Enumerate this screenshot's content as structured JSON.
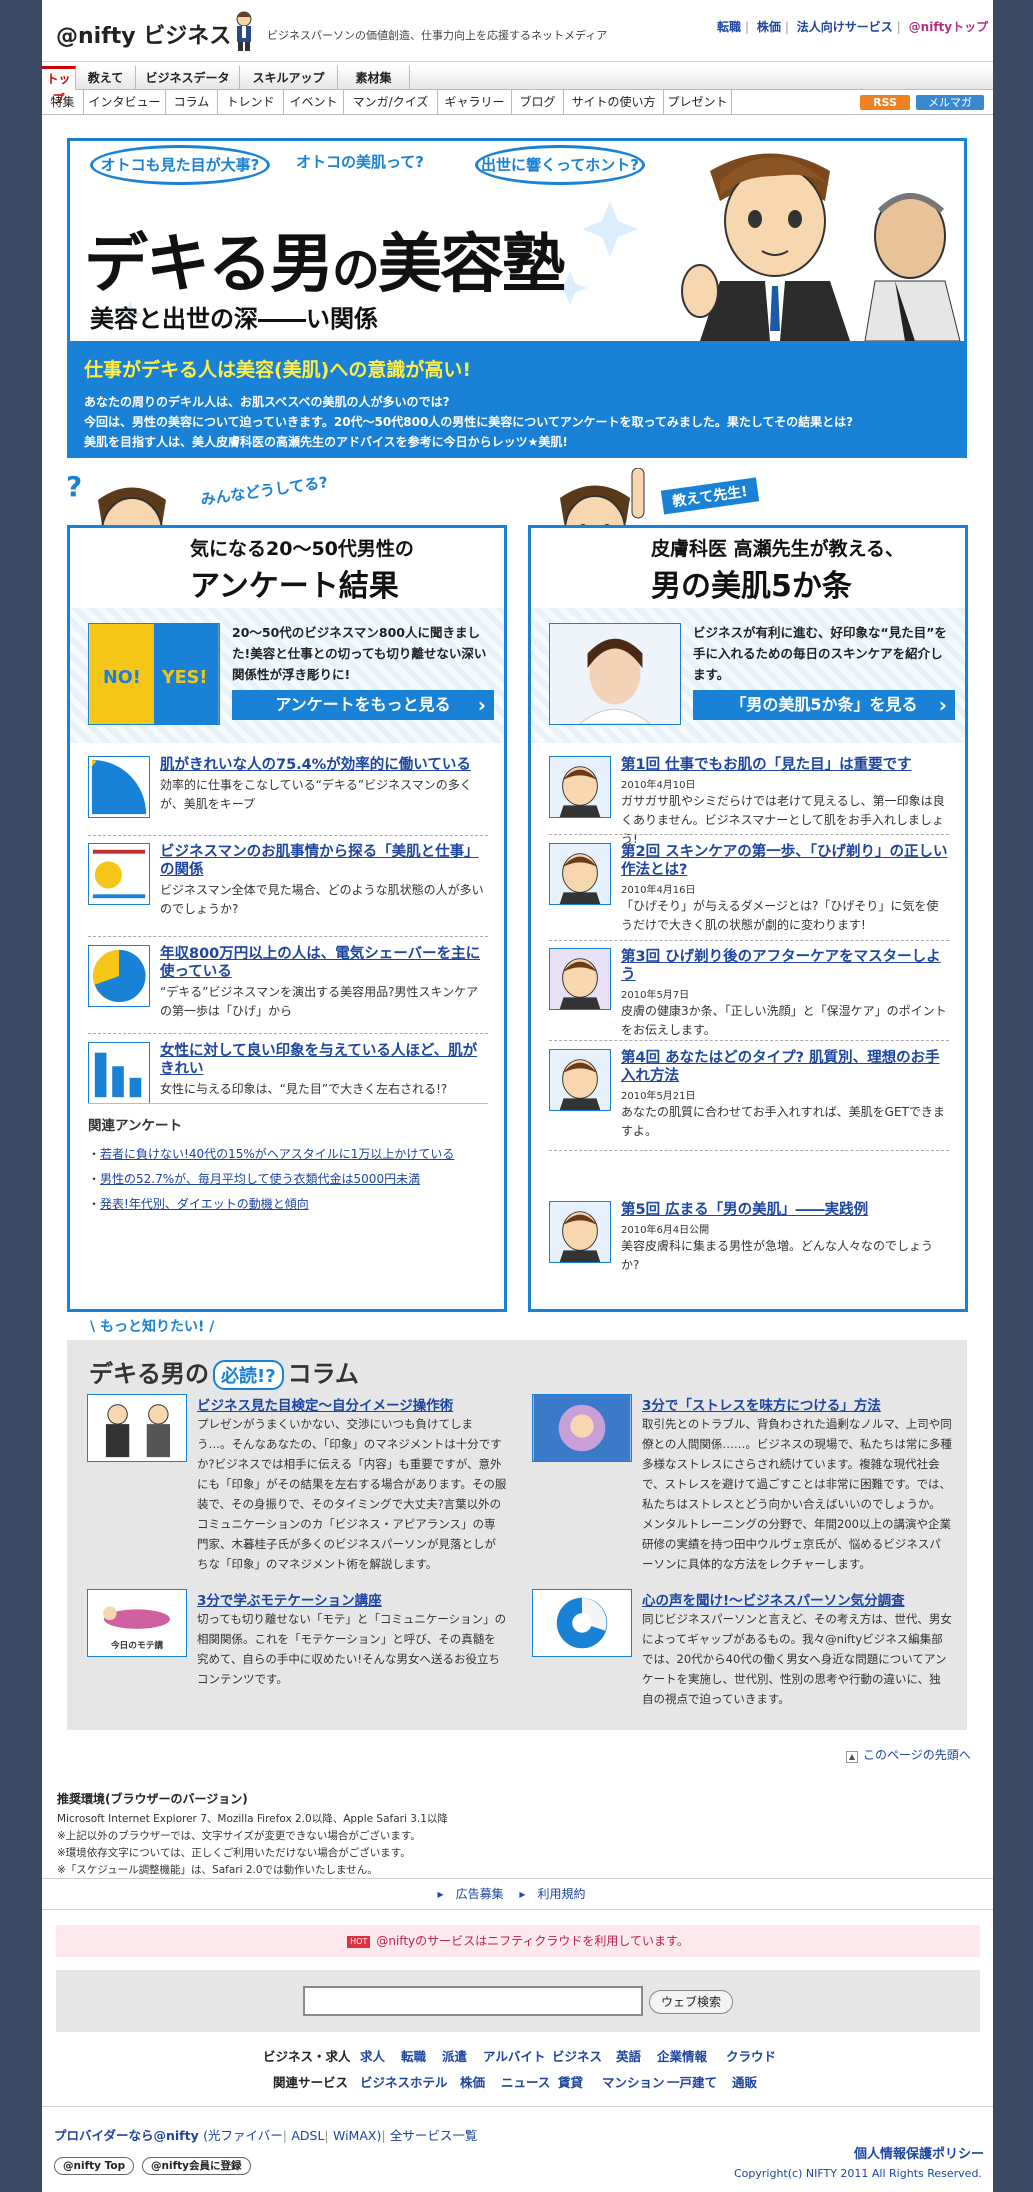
{
  "header": {
    "logo": "@nifty ビジネス",
    "tagline": "ビジネスパーソンの価値創造、仕事力向上を応援するネットメディア",
    "toplinks": [
      "転職",
      "株価",
      "法人向けサービス",
      "@niftyトップ"
    ]
  },
  "nav1": [
    "トップ",
    "教えて",
    "ビジネスデータ",
    "スキルアップ",
    "素材集"
  ],
  "nav2": [
    "特集",
    "インタビュー",
    "コラム",
    "トレンド",
    "イベント",
    "マンガ/クイズ",
    "ギャラリー",
    "ブログ",
    "サイトの使い方",
    "プレゼント"
  ],
  "feeds": {
    "rss": "RSS",
    "mail": "メルマガ"
  },
  "hero": {
    "bubbles": [
      "オトコも見た目が大事?",
      "オトコの美肌って?",
      "出世に響くってホント?"
    ],
    "title_a": "デキる男",
    "title_b": "の",
    "title_c": "美容塾",
    "subtitle": "美容と出世の深――い関係",
    "lead": "仕事がデキる人は美容(美肌)への意識が高い!",
    "body": [
      "あなたの周りのデキル人は、お肌スベスベの美肌の人が多いのでは?",
      "今回は、男性の美容について迫っていきます。20代〜50代800人の男性に美容についてアンケートを取ってみました。果たしてその結果とは?",
      "美肌を目指す人は、美人皮膚科医の高瀬先生のアドバイスを参考に今日からレッツ★美肌!"
    ]
  },
  "left": {
    "badge": "みんなどうしてる?",
    "title1": "気になる20〜50代男性の",
    "title2": "アンケート結果",
    "feat_text": "20〜50代のビジネスマン800人に聞きました!美容と仕事との切っても切り離せない深い関係性が浮き彫りに!",
    "feat_btn": "アンケートをもっと見る",
    "pie_no": "NO!",
    "pie_yes": "YES!",
    "items": [
      {
        "title": "肌がきれいな人の75.4%が効率的に働いている",
        "desc": "効率的に仕事をこなしている“デキる”ビジネスマンの多くが、美肌をキープ"
      },
      {
        "title": "ビジネスマンのお肌事情から探る「美肌と仕事」の関係",
        "desc": "ビジネスマン全体で見た場合、どのような肌状態の人が多いのでしょうか?"
      },
      {
        "title": "年収800万円以上の人は、電気シェーバーを主に使っている",
        "desc": "“デキる”ビジネスマンを演出する美容用品?男性スキンケアの第一歩は「ひげ」から"
      },
      {
        "title": "女性に対して良い印象を与えている人ほど、肌がきれい",
        "desc": "女性に与える印象は、“見た目”で大きく左右される!?"
      }
    ],
    "related_title": "関連アンケート",
    "related": [
      "若者に負けない!40代の15%がヘアスタイルに1万以上かけている",
      "男性の52.7%が、毎月平均して使う衣類代金は5000円未満",
      "発表!年代別、ダイエットの動機と傾向"
    ]
  },
  "right": {
    "badge": "教えて先生!",
    "title1": "皮膚科医 高瀬先生が教える、",
    "title2": "男の美肌5か条",
    "feat_text": "ビジネスが有利に進む、好印象な“見た目”を手に入れるための毎日のスキンケアを紹介します。",
    "feat_btn": "「男の美肌5か条」を見る",
    "items": [
      {
        "title": "第1回 仕事でもお肌の「見た目」は重要です",
        "date": "2010年4月10日",
        "desc": "ガサガサ肌やシミだらけでは老けて見えるし、第一印象は良くありません。ビジネスマナーとして肌をお手入れしましょう!"
      },
      {
        "title": "第2回 スキンケアの第一歩、「ひげ剃り」の正しい作法とは?",
        "date": "2010年4月16日",
        "desc": "「ひげそり」が与えるダメージとは?「ひげそり」に気を使うだけで大きく肌の状態が劇的に変わります!"
      },
      {
        "title": "第3回 ひげ剃り後のアフターケアをマスターしよう",
        "date": "2010年5月7日",
        "desc": "皮膚の健康3か条、「正しい洗顔」と「保湿ケア」のポイントをお伝えします。"
      },
      {
        "title": "第4回 あなたはどのタイプ? 肌質別、理想のお手入れ方法",
        "date": "2010年5月21日",
        "desc": "あなたの肌質に合わせてお手入れすれば、美肌をGETできますよ。"
      },
      {
        "title": "第5回 広まる「男の美肌」――実践例",
        "date": "2010年6月4日公開",
        "desc": "美容皮膚科に集まる男性が急増。どんな人々なのでしょうか?"
      }
    ]
  },
  "more": {
    "label": "\\ もっと知りたい! /",
    "title_a": "デキる男の",
    "title_hi": "必読!?",
    "title_b": "コラム",
    "items": [
      {
        "title": "ビジネス見た目検定〜自分イメージ操作術",
        "desc": "プレゼンがうまくいかない、交渉にいつも負けてしまう…。そんなあなたの、「印象」のマネジメントは十分ですか?ビジネスでは相手に伝える「内容」も重要ですが、意外にも「印象」がその結果を左右する場合があります。その服装で、その身振りで、そのタイミングで大丈夫?言葉以外のコミュニケーションのカ「ビジネス・アピアランス」の専門家、木暮桂子氏が多くのビジネスパーソンが見落としがちな「印象」のマネジメント術を解説します。"
      },
      {
        "title": "3分で「ストレスを味方につける」方法",
        "desc": "取引先とのトラブル、背負わされた過剰なノルマ、上司や同僚との人間関係……。ビジネスの現場で、私たちは常に多種多様なストレスにさらされ続けています。複雑な現代社会で、ストレスを避けて過ごすことは非常に困難です。では、私たちはストレスとどう向かい合えばいいのでしょうか。メンタルトレーニングの分野で、年間200以上の講演や企業研修の実績を持つ田中ウルヴェ京氏が、悩めるビジネスパーソンに具体的な方法をレクチャーします。"
      },
      {
        "title": "3分で学ぶモテケーション講座",
        "img_label": "今日のモテ講",
        "desc": "切っても切り離せない「モテ」と「コミュニケーション」の相関関係。これを「モテケーション」と呼び、その真髄を究めて、自らの手中に収めたい!そんな男女へ送るお役立ちコンテンツです。"
      },
      {
        "title": "心の声を聞け!〜ビジネスパーソン気分調査",
        "desc": "同じビジネスパーソンと言えど、その考え方は、世代、男女によってギャップがあるもの。我々@niftyビジネス編集部では、20代から40代の働く男女へ身近な問題についてアンケートを実施し、世代別、性別の思考や行動の違いに、独自の視点で迫っていきます。"
      }
    ]
  },
  "pagetop": "このページの先頭へ",
  "env": {
    "title": "推奨環境(ブラウザーのバージョン)",
    "lines": [
      "Microsoft Internet Explorer 7、Mozilla Firefox 2.0以降、Apple Safari 3.1以降",
      "※上記以外のブラウザーでは、文字サイズが変更できない場合がございます。",
      "※環境依存文字については、正しくご利用いただけない場合がございます。",
      "※「スケジュール調整機能」は、Safari 2.0では動作いたしません。"
    ]
  },
  "footlinks": [
    "広告募集",
    "利用規約"
  ],
  "cloud": {
    "hot": "HOT",
    "text": "@niftyのサービスはニフティクラウドを利用しています。"
  },
  "search": {
    "value": "",
    "button": "ウェブ検索"
  },
  "biz": {
    "label": "ビジネス・求人",
    "links": [
      "求人",
      "転職",
      "派遣",
      "アルバイト",
      "ビジネス",
      "英語",
      "企業情報",
      "クラウド"
    ]
  },
  "rel": {
    "label": "関連サービス",
    "links": [
      "ビジネスホテル",
      "株価",
      "ニュース",
      "賃貸",
      "マンション",
      "一戸建て",
      "通販"
    ]
  },
  "bottom": {
    "provider": "プロバイダーなら@nifty",
    "links": [
      "(光ファイバー",
      "ADSL",
      "WiMAX)",
      "全サービス一覧"
    ],
    "pill1": "@nifty Top",
    "pill2": "@nifty会員に登録",
    "privacy": "個人情報保護ポリシー",
    "copyright": "Copyright(c) NIFTY 2011 All Rights Reserved."
  }
}
